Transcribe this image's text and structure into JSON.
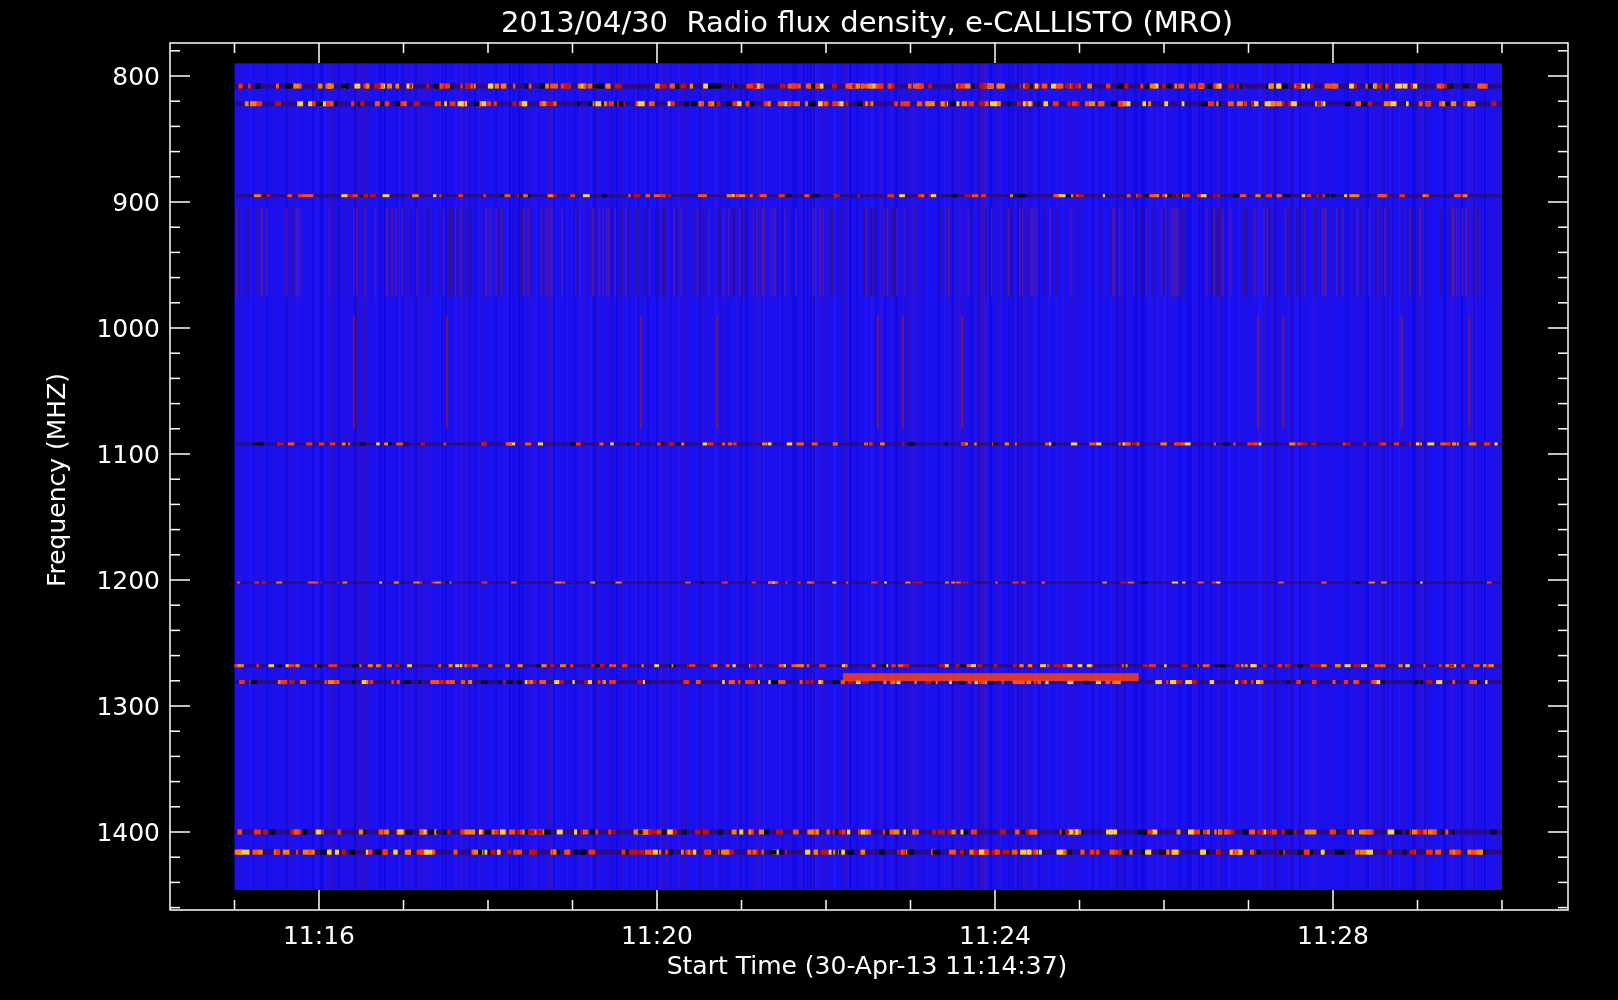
{
  "title": "2013/04/30  Radio flux density, e-CALLISTO (MRO)",
  "y_axis": {
    "label": "Frequency (MHZ)",
    "ticks": [
      "800",
      "900",
      "1000",
      "1100",
      "1200",
      "1300",
      "1400"
    ]
  },
  "x_axis": {
    "label": "Start Time (30-Apr-13 11:14:37)",
    "ticks": [
      "11:16",
      "11:20",
      "11:24",
      "11:28"
    ]
  }
}
